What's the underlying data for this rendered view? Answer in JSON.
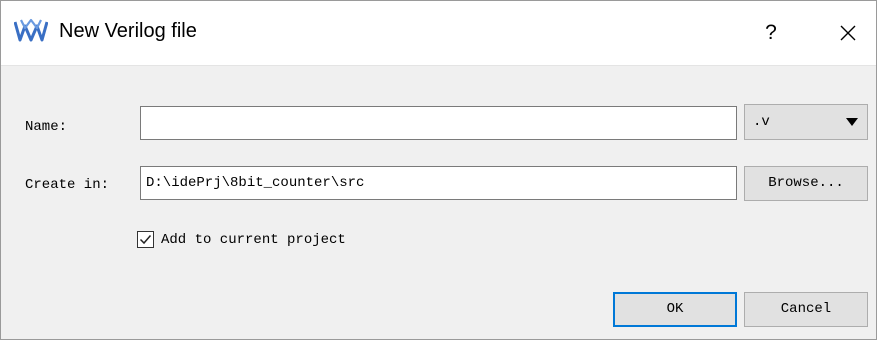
{
  "dialog": {
    "title": "New Verilog file",
    "help_label": "?",
    "name_label": "Name:",
    "name_value": "",
    "extension": ".v",
    "create_in_label": "Create in:",
    "create_in_value": "D:\\idePrj\\8bit_counter\\src",
    "browse_label": "Browse...",
    "add_to_project_label": "Add to current project",
    "add_to_project_checked": true,
    "ok_label": "OK",
    "cancel_label": "Cancel"
  },
  "icons": {
    "app": "gowin-logo-icon",
    "close": "close-icon",
    "dropdown": "chevron-down-icon",
    "check": "checkmark-icon"
  },
  "colors": {
    "accent": "#0078d7",
    "logo": "#3a6fc4"
  }
}
